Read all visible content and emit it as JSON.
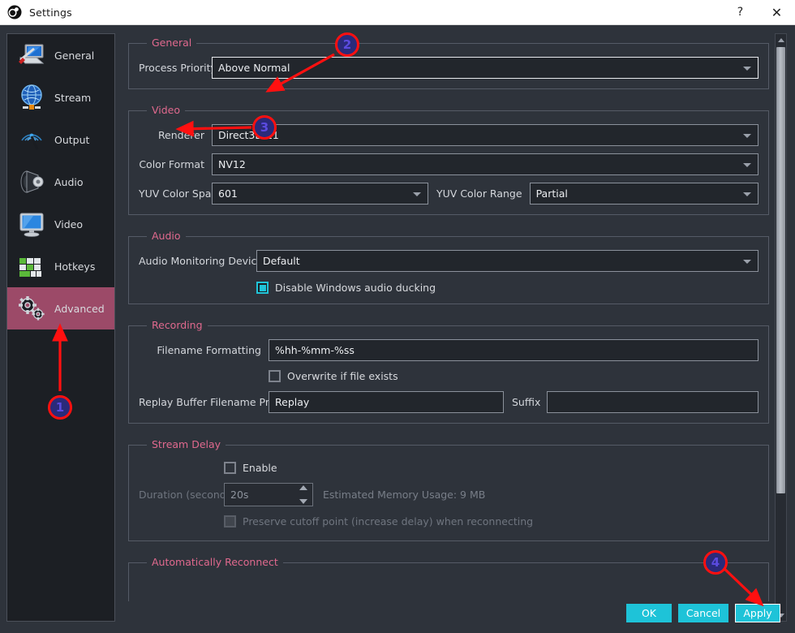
{
  "window": {
    "title": "Settings",
    "logo_icon": "obs-logo-icon",
    "help_label": "?",
    "close_label": "✕"
  },
  "sidebar": {
    "items": [
      {
        "label": "General",
        "icon": "general-icon",
        "selected": false
      },
      {
        "label": "Stream",
        "icon": "stream-icon",
        "selected": false
      },
      {
        "label": "Output",
        "icon": "output-icon",
        "selected": false
      },
      {
        "label": "Audio",
        "icon": "audio-icon",
        "selected": false
      },
      {
        "label": "Video",
        "icon": "video-icon",
        "selected": false
      },
      {
        "label": "Hotkeys",
        "icon": "hotkeys-icon",
        "selected": false
      },
      {
        "label": "Advanced",
        "icon": "advanced-icon",
        "selected": true
      }
    ]
  },
  "groups": {
    "general": {
      "title": "General",
      "process_priority_label": "Process Priority",
      "process_priority_value": "Above Normal"
    },
    "video": {
      "title": "Video",
      "renderer_label": "Renderer",
      "renderer_value": "Direct3D 11",
      "color_format_label": "Color Format",
      "color_format_value": "NV12",
      "yuv_color_space_label": "YUV Color Space",
      "yuv_color_space_value": "601",
      "yuv_color_range_label": "YUV Color Range",
      "yuv_color_range_value": "Partial"
    },
    "audio": {
      "title": "Audio",
      "monitoring_device_label": "Audio Monitoring Device",
      "monitoring_device_value": "Default",
      "ducking_label": "Disable Windows audio ducking",
      "ducking_checked": true
    },
    "recording": {
      "title": "Recording",
      "filename_formatting_label": "Filename Formatting",
      "filename_formatting_value": "%hh-%mm-%ss",
      "overwrite_label": "Overwrite if file exists",
      "overwrite_checked": false,
      "replay_prefix_label": "Replay Buffer Filename Prefix",
      "replay_prefix_value": "Replay",
      "suffix_label": "Suffix",
      "suffix_value": ""
    },
    "stream_delay": {
      "title": "Stream Delay",
      "enable_label": "Enable",
      "enable_checked": false,
      "duration_label": "Duration (seconds)",
      "duration_value": "20s",
      "memory_usage_text": "Estimated Memory Usage: 9 MB",
      "preserve_label": "Preserve cutoff point (increase delay) when reconnecting",
      "preserve_checked": false
    },
    "auto_reconnect": {
      "title": "Automatically Reconnect"
    }
  },
  "buttons": {
    "ok": "OK",
    "cancel": "Cancel",
    "apply": "Apply"
  },
  "annotations": [
    {
      "number": "1"
    },
    {
      "number": "2"
    },
    {
      "number": "3"
    },
    {
      "number": "4"
    }
  ],
  "colors": {
    "accent_cyan": "#1ec3d8",
    "group_title_pink": "#e0698e",
    "selected_sidebar": "#9c4a68",
    "annotation_red": "#ff1010",
    "window_bg": "#2e333b"
  }
}
